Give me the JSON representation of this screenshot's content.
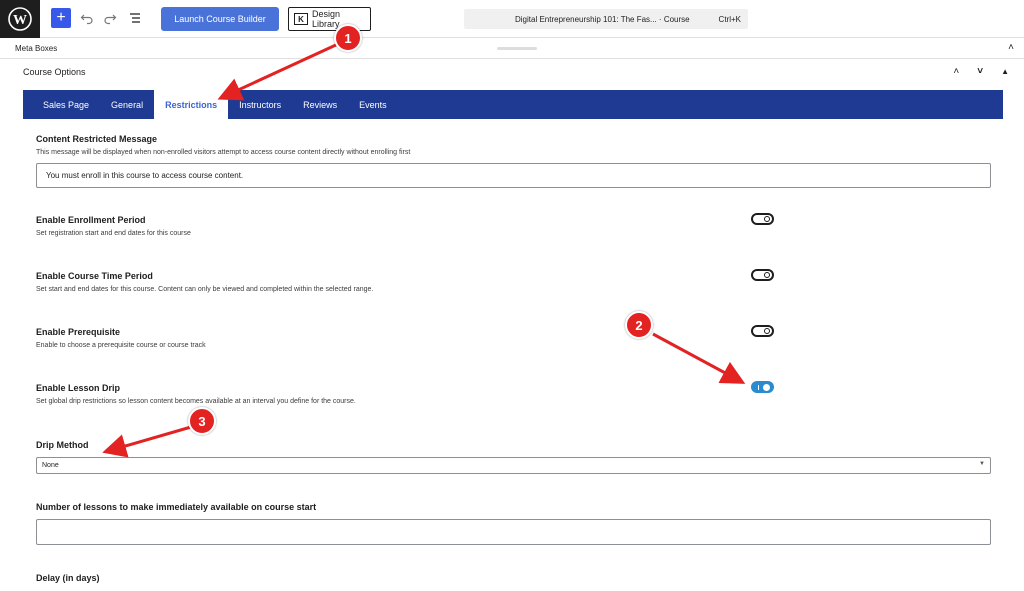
{
  "toolbar": {
    "launch_label": "Launch Course Builder",
    "design_label": "Design Library",
    "command_title": "Digital Entrepreneurship 101: The Fas... · Course",
    "command_shortcut": "Ctrl+K"
  },
  "meta_boxes": {
    "label": "Meta Boxes"
  },
  "course_options": {
    "label": "Course Options"
  },
  "tabs": [
    {
      "label": "Sales Page"
    },
    {
      "label": "General"
    },
    {
      "label": "Restrictions"
    },
    {
      "label": "Instructors"
    },
    {
      "label": "Reviews"
    },
    {
      "label": "Events"
    }
  ],
  "fields": {
    "restricted_message": {
      "title": "Content Restricted Message",
      "desc": "This message will be displayed when non-enrolled visitors attempt to access course content directly without enrolling first",
      "value": "You must enroll in this course to access course content."
    },
    "enrollment_period": {
      "title": "Enable Enrollment Period",
      "desc": "Set registration start and end dates for this course",
      "enabled": false
    },
    "course_time_period": {
      "title": "Enable Course Time Period",
      "desc": "Set start and end dates for this course. Content can only be viewed and completed within the selected range.",
      "enabled": false
    },
    "prerequisite": {
      "title": "Enable Prerequisite",
      "desc": "Enable to choose a prerequisite course or course track",
      "enabled": false
    },
    "lesson_drip": {
      "title": "Enable Lesson Drip",
      "desc": "Set global drip restrictions so lesson content becomes available at an interval you define for the course.",
      "enabled": true
    },
    "drip_method": {
      "title": "Drip Method",
      "value": "None"
    },
    "lessons_available": {
      "title": "Number of lessons to make immediately available on course start",
      "value": ""
    },
    "delay": {
      "title": "Delay (in days)"
    }
  },
  "annotations": [
    "1",
    "2",
    "3"
  ],
  "colors": {
    "tab_bar": "#1f3a93",
    "active_tab_text": "#3b63d6",
    "launch_button": "#4a73d9",
    "toggle_on": "#2a8ccf",
    "annotation": "#e32222"
  }
}
